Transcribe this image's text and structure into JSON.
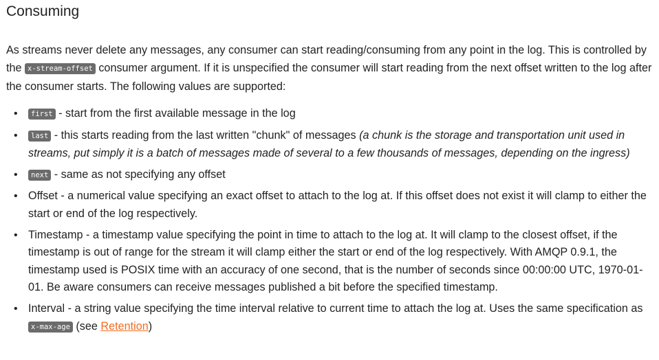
{
  "heading": "Consuming",
  "intro": {
    "text_1": "As streams never delete any messages, any consumer can start reading/consuming from any point in the log. This is controlled by the ",
    "code": "x-stream-offset",
    "text_2": " consumer argument. If it is unspecified the consumer will start reading from the next offset written to the log after the consumer starts. The following values are supported:"
  },
  "items": [
    {
      "code": "first",
      "text": " - start from the first available message in the log"
    },
    {
      "code": "last",
      "text": " - this starts reading from the last written \"chunk\" of messages ",
      "note": "(a chunk is the storage and transportation unit used in streams, put simply it is a batch of messages made of several to a few thousands of messages, depending on the ingress)"
    },
    {
      "code": "next",
      "text": " - same as not specifying any offset"
    },
    {
      "text": "Offset - a numerical value specifying an exact offset to attach to the log at. If this offset does not exist it will clamp to either the start or end of the log respectively."
    },
    {
      "text": "Timestamp - a timestamp value specifying the point in time to attach to the log at. It will clamp to the closest offset, if the timestamp is out of range for the stream it will clamp either the start or end of the log respectively. With AMQP 0.9.1, the timestamp used is POSIX time with an accuracy of one second, that is the number of seconds since 00:00:00 UTC, 1970-01-01. Be aware consumers can receive messages published a bit before the specified timestamp."
    },
    {
      "text": "Interval - a string value specifying the time interval relative to current time to attach the log at. Uses the same specification as ",
      "code": "x-max-age",
      "text_2": " (see ",
      "link": "Retention",
      "text_3": ")"
    }
  ],
  "bullet_char": "•",
  "link_color": "#f26b21"
}
